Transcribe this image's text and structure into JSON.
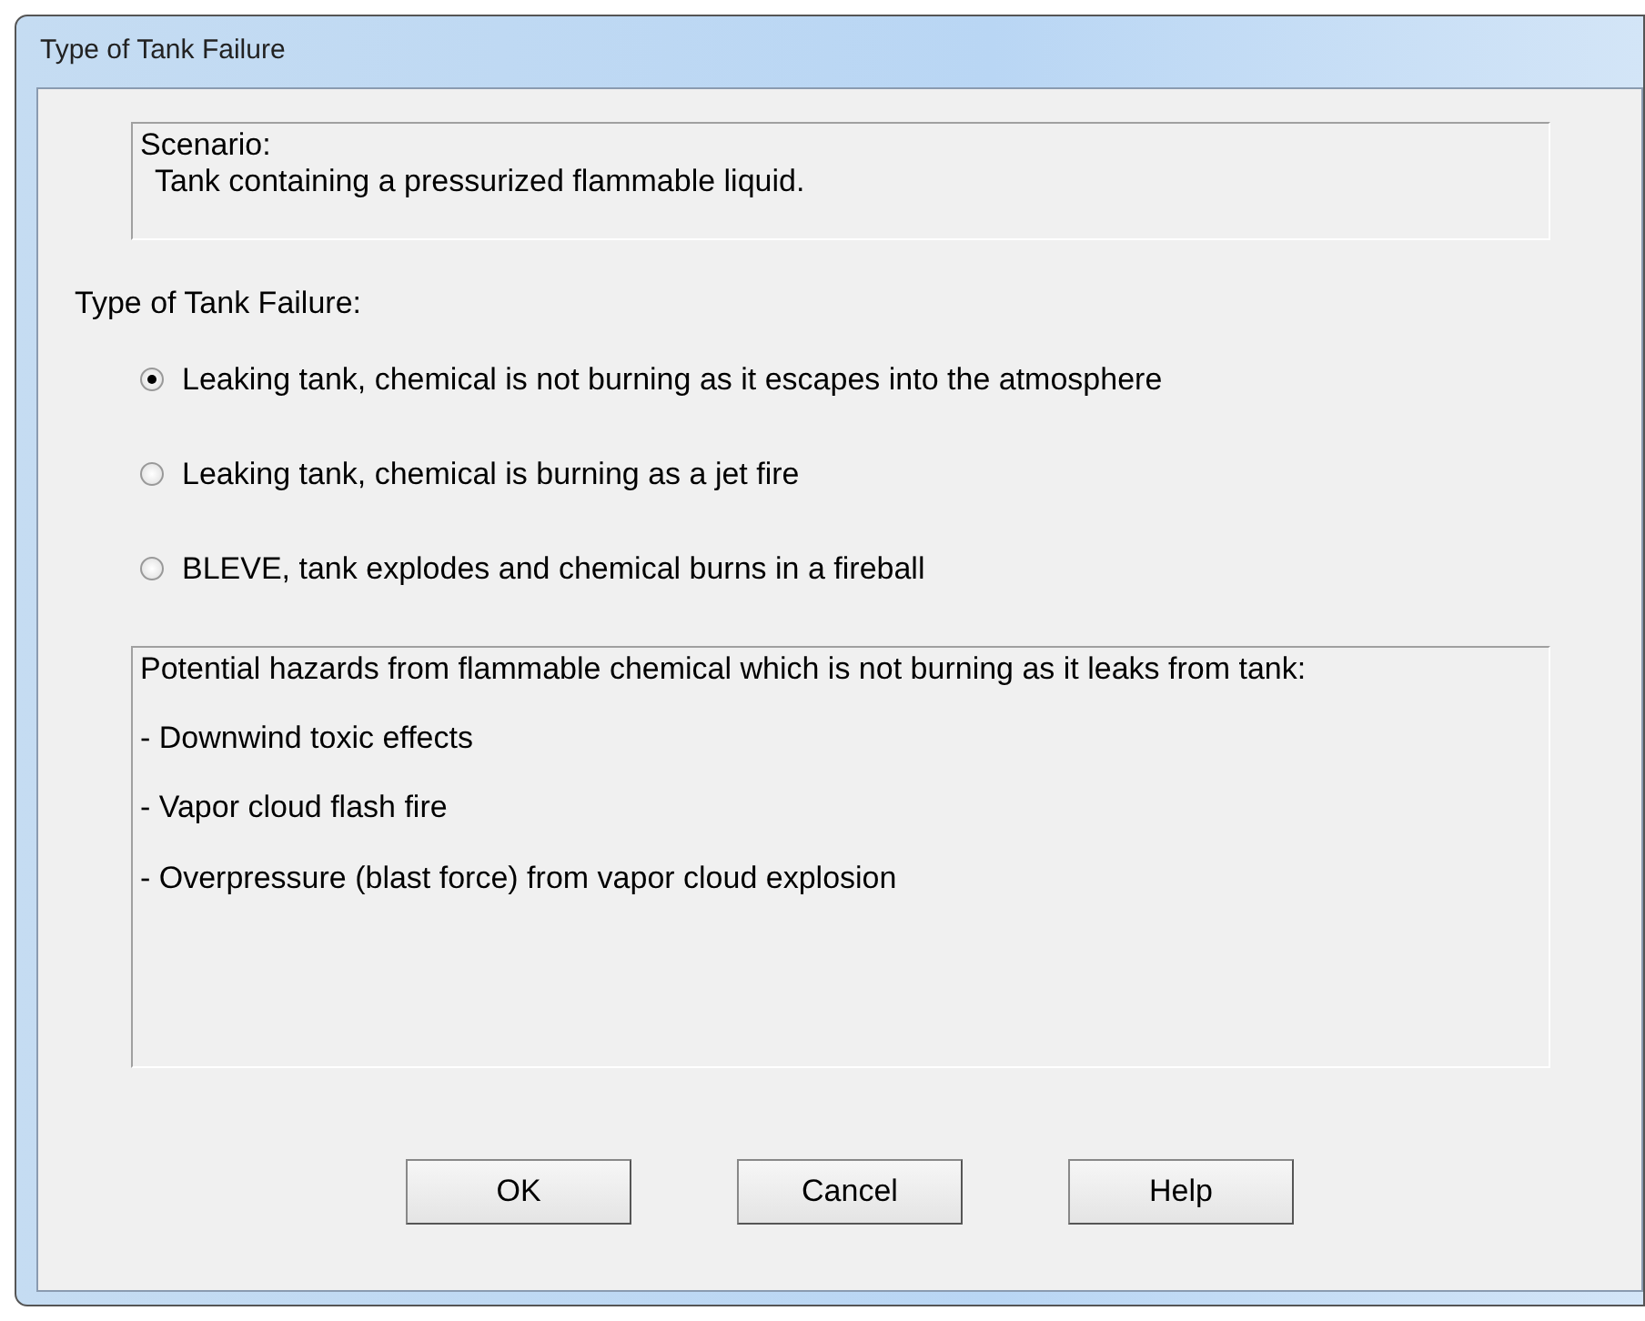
{
  "window": {
    "title": "Type of Tank Failure"
  },
  "scenario": {
    "heading": "Scenario:",
    "text": "Tank containing a pressurized flammable liquid."
  },
  "failure_type": {
    "label": "Type of Tank Failure:",
    "options": [
      {
        "label": "Leaking tank, chemical is not burning as it escapes into the atmosphere",
        "selected": true
      },
      {
        "label": "Leaking tank, chemical is burning as a jet fire",
        "selected": false
      },
      {
        "label": "BLEVE, tank explodes and chemical burns in a fireball",
        "selected": false
      }
    ]
  },
  "hazards": {
    "intro": "Potential hazards from flammable chemical which is not burning as it leaks from tank:",
    "items": [
      "- Downwind toxic effects",
      "- Vapor cloud flash fire",
      "- Overpressure (blast force) from vapor cloud explosion"
    ]
  },
  "buttons": [
    "OK",
    "Cancel",
    "Help"
  ]
}
